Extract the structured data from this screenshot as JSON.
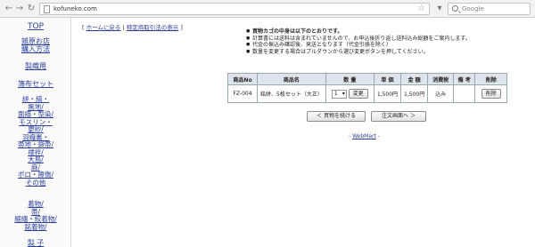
{
  "browser": {
    "url": "kofuneko.com",
    "search_placeholder": "Google"
  },
  "sidebar": {
    "items": [
      "TOP",
      "雑 原 お 店 購 入 方 法",
      "製 織 用",
      "簿 布 セ ッ ト",
      "絣・縞・無地/ 面描・型染/ モスリン・ 更紗/ 羽織裏・ 帯地・袋帯/ 襦袢/ 大島/ 麻/ ポロ・擦傷/ その他",
      "着物/ 帯/ 縮緬・絞着物/ 銘着物/",
      "製 子"
    ]
  },
  "breadcrumb": {
    "open": "[",
    "home": "ホームに戻る",
    "sep": "|",
    "law": "特定商取引法の表示",
    "close": "]"
  },
  "notice": {
    "heading": "買物カゴの中身は以下のとおりです。",
    "lines": [
      "計算書には送料は含まれていませんので、お申込後折り返し送料込み総額をご案内します。",
      "代金の振込み確認後、発送となります（代金引換を除く）",
      "数量を変更する場合はプルダウンから選び変更ボタンを押してください。"
    ]
  },
  "cart": {
    "headers": [
      "商品No",
      "商品名",
      "数 量",
      "単 価",
      "金 額",
      "消費税",
      "備 考",
      "削除"
    ],
    "rows": [
      {
        "no": "FZ-004",
        "name": "銘絣、5枚セット（大正）",
        "qty": "1",
        "change_label": "変更",
        "unit_price": "1,500円",
        "amount": "1,500円",
        "tax": "込み",
        "note": "",
        "delete_label": "削除"
      }
    ]
  },
  "buttons": {
    "continue": "＜ 買物を続ける",
    "order": "注文画面へ ＞"
  },
  "footer": {
    "link": "WebMart"
  }
}
